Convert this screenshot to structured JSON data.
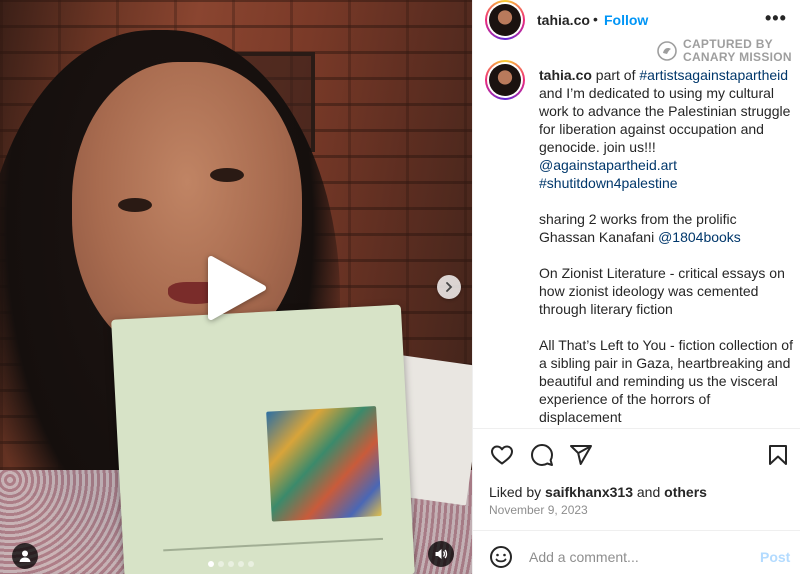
{
  "post": {
    "username": "tahia.co",
    "separator": "•",
    "follow_label": "Follow",
    "more_label": "•••",
    "watermark": {
      "line1": "CAPTURED BY",
      "line2": "CANARY MISSION"
    },
    "caption": {
      "username": "tahia.co",
      "intro_text": "part of",
      "hashtag1": "#artistsagainstapartheid",
      "text1": "and I’m dedicated to using my cultural work to advance the Palestinian struggle for liberation against occupation and genocide. join us!!!",
      "mention1": "@againstapartheid.art",
      "hashtag2": "#shutitdown4palestine",
      "para2": "sharing 2 works from the prolific Ghassan Kanafani",
      "mention2": "@1804books",
      "para3": "On Zionist Literature - critical essays on how zionist ideology was cemented through literary fiction",
      "para4": "All That’s Left to You - fiction collection of a sibling pair in Gaza, heartbreaking and beautiful and reminding us the visceral experience of the horrors of displacement"
    },
    "likes": {
      "prefix": "Liked by",
      "user": "saifkhanx313",
      "connector": "and",
      "others": "others"
    },
    "date": "November 9, 2023",
    "comment": {
      "placeholder": "Add a comment...",
      "post_label": "Post"
    },
    "media": {
      "slide_count": 5,
      "active_slide": 1
    }
  },
  "icons": [
    "play-icon",
    "chevron-right-icon",
    "user-tag-icon",
    "audio-icon",
    "heart-icon",
    "comment-icon",
    "share-icon",
    "bookmark-icon",
    "emoji-icon",
    "canary-logo-icon"
  ],
  "colors": {
    "link": "#00376b",
    "follow": "#0095f6",
    "post_disabled": "#b3dbff",
    "muted": "#8e8e8e"
  }
}
